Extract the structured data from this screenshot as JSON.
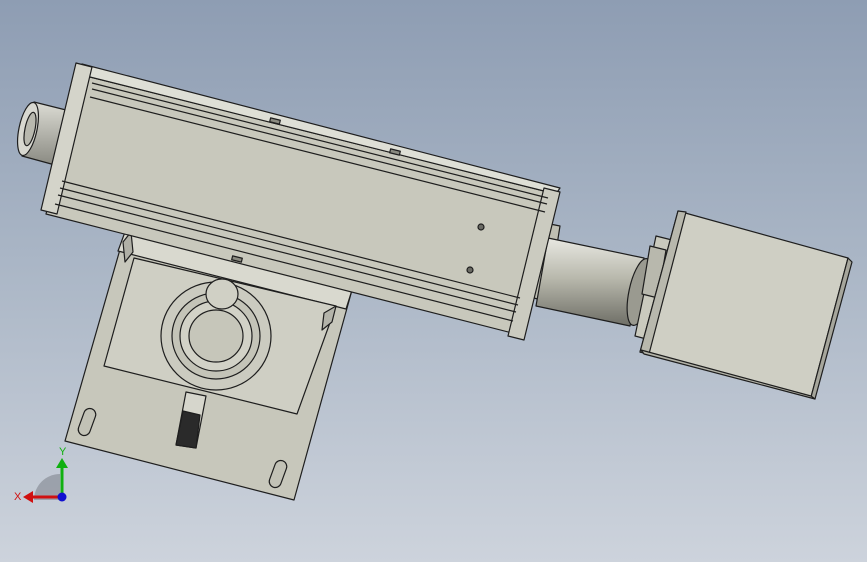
{
  "viewport": {
    "background_top": "#8e9db3",
    "background_bottom": "#cdd3dc"
  },
  "triad": {
    "x_label": "X",
    "y_label": "Y",
    "x_color": "#d01010",
    "y_color": "#10b010",
    "z_color": "#1010d0"
  },
  "model": {
    "body_color": "#c8c8bc",
    "edge_color": "#1e1e1e"
  }
}
